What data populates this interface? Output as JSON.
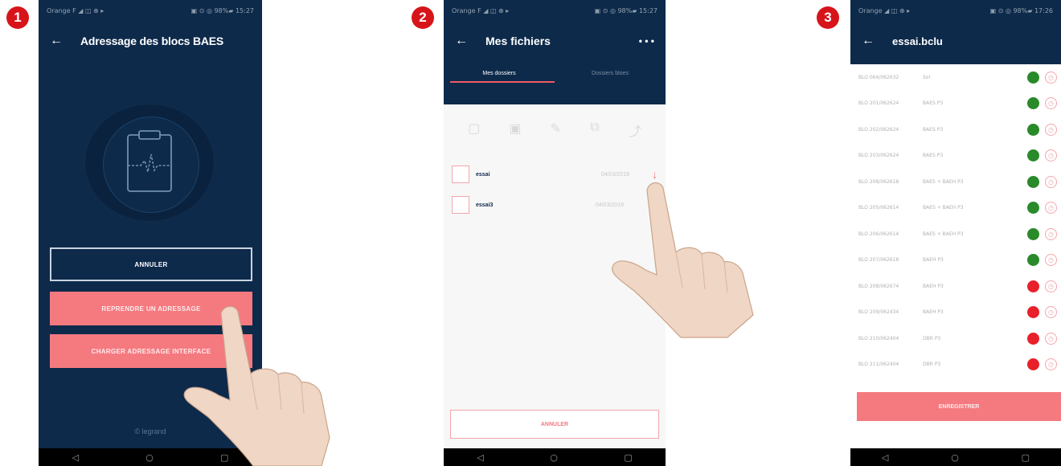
{
  "steps": [
    "1",
    "2",
    "3"
  ],
  "screen1": {
    "status_left": "Orange F ◢ ◫ ⊕ ▸",
    "status_right": "▣ ⊙ ◎ 98%▰ 15:27",
    "title": "Adressage des blocs BAES",
    "btn_cancel": "ANNULER",
    "btn_resume": "REPRENDRE UN ADRESSAGE",
    "btn_load": "CHARGER ADRESSAGE INTERFACE",
    "footer": "© legrand"
  },
  "screen2": {
    "status_left": "Orange F ◢ ◫ ⊕ ▸",
    "status_right": "▣ ⊙ ◎ 98%▰ 15:27",
    "title": "Mes fichiers",
    "menu": "• • •",
    "tabs": [
      "Mes dossiers",
      "Dossiers bloes"
    ],
    "files": [
      {
        "name": "essai",
        "date": "04/03/2019"
      },
      {
        "name": "essai3",
        "date": "04/03/2019"
      }
    ],
    "cancel": "ANNULER"
  },
  "screen3": {
    "status_left": "Orange ◢ ◫ ⊕ ▸",
    "status_right": "▣ ⊙ ◎ 98%▰ 17:26",
    "title": "essai.bclu",
    "rows": [
      {
        "id": "BLO 064/062632",
        "type": "Sol",
        "status": "green"
      },
      {
        "id": "BLO 201/062624",
        "type": "BAES P3",
        "status": "green"
      },
      {
        "id": "BLO 202/062624",
        "type": "BAES P3",
        "status": "green"
      },
      {
        "id": "BLO 203/062624",
        "type": "BAES P3",
        "status": "green"
      },
      {
        "id": "BLO 208/062618",
        "type": "BAES + BAEH P3",
        "status": "green"
      },
      {
        "id": "BLO 205/062614",
        "type": "BAES + BAEH P3",
        "status": "green"
      },
      {
        "id": "BLO 206/062614",
        "type": "BAES + BAEH P3",
        "status": "green"
      },
      {
        "id": "BLO 207/062618",
        "type": "BAEH P3",
        "status": "green"
      },
      {
        "id": "BLO 208/062674",
        "type": "BAEH P3",
        "status": "red"
      },
      {
        "id": "BLO 209/062434",
        "type": "BAEH P3",
        "status": "red"
      },
      {
        "id": "BLO 210/062404",
        "type": "DBR P3",
        "status": "red"
      },
      {
        "id": "BLO 211/062404",
        "type": "DBR P3",
        "status": "red"
      }
    ],
    "save": "ENREGISTRER"
  },
  "navbar": {
    "back": "◁",
    "home": "○",
    "recent": "▢"
  },
  "colors": {
    "navy": "#0d2a4b",
    "coral": "#f47a80",
    "green": "#2a8a2a",
    "red": "#e8202a",
    "badge": "#d7141a"
  }
}
